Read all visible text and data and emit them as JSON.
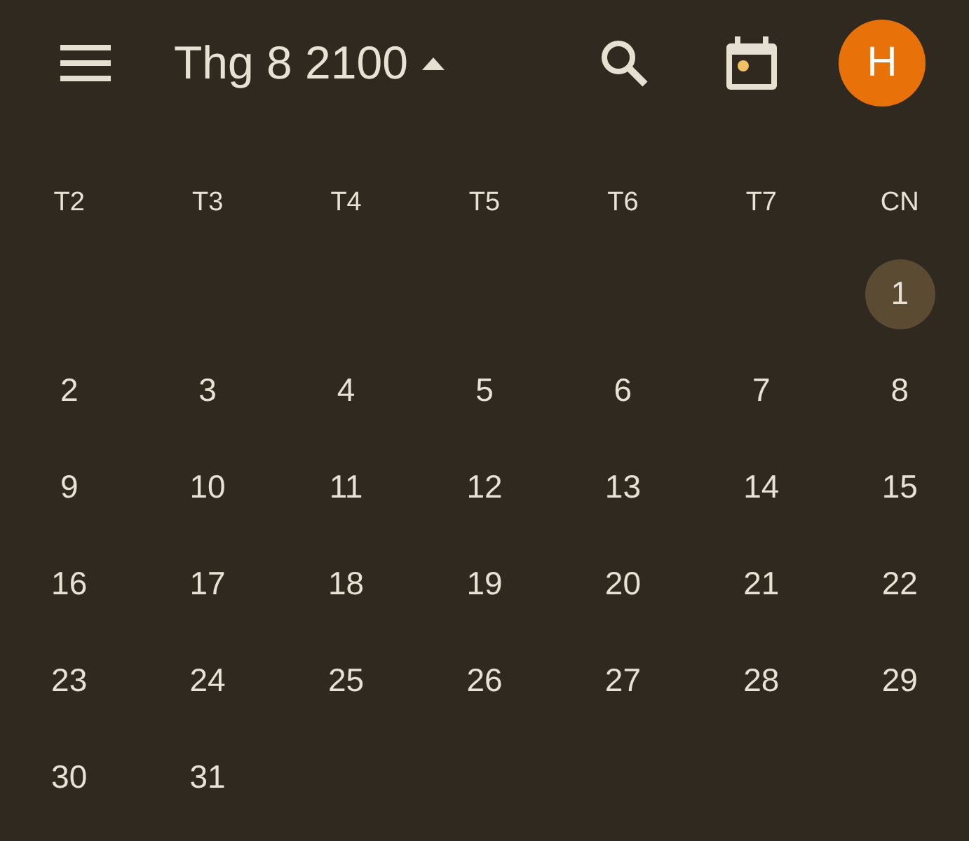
{
  "header": {
    "title": "Thg 8 2100",
    "avatar": "H"
  },
  "weekdays": [
    "T2",
    "T3",
    "T4",
    "T5",
    "T6",
    "T7",
    "CN"
  ],
  "weeks": [
    {
      "kind": "first",
      "days": [
        {
          "label": "1",
          "selected": true
        }
      ]
    },
    {
      "kind": "full",
      "days": [
        {
          "label": "2",
          "selected": false
        },
        {
          "label": "3",
          "selected": false
        },
        {
          "label": "4",
          "selected": false
        },
        {
          "label": "5",
          "selected": false
        },
        {
          "label": "6",
          "selected": false
        },
        {
          "label": "7",
          "selected": false
        },
        {
          "label": "8",
          "selected": false
        }
      ]
    },
    {
      "kind": "full",
      "days": [
        {
          "label": "9",
          "selected": false
        },
        {
          "label": "10",
          "selected": false
        },
        {
          "label": "11",
          "selected": false
        },
        {
          "label": "12",
          "selected": false
        },
        {
          "label": "13",
          "selected": false
        },
        {
          "label": "14",
          "selected": false
        },
        {
          "label": "15",
          "selected": false
        }
      ]
    },
    {
      "kind": "full",
      "days": [
        {
          "label": "16",
          "selected": false
        },
        {
          "label": "17",
          "selected": false
        },
        {
          "label": "18",
          "selected": false
        },
        {
          "label": "19",
          "selected": false
        },
        {
          "label": "20",
          "selected": false
        },
        {
          "label": "21",
          "selected": false
        },
        {
          "label": "22",
          "selected": false
        }
      ]
    },
    {
      "kind": "full",
      "days": [
        {
          "label": "23",
          "selected": false
        },
        {
          "label": "24",
          "selected": false
        },
        {
          "label": "25",
          "selected": false
        },
        {
          "label": "26",
          "selected": false
        },
        {
          "label": "27",
          "selected": false
        },
        {
          "label": "28",
          "selected": false
        },
        {
          "label": "29",
          "selected": false
        }
      ]
    },
    {
      "kind": "last",
      "days": [
        {
          "label": "30",
          "selected": false
        },
        {
          "label": "31",
          "selected": false
        }
      ]
    }
  ]
}
